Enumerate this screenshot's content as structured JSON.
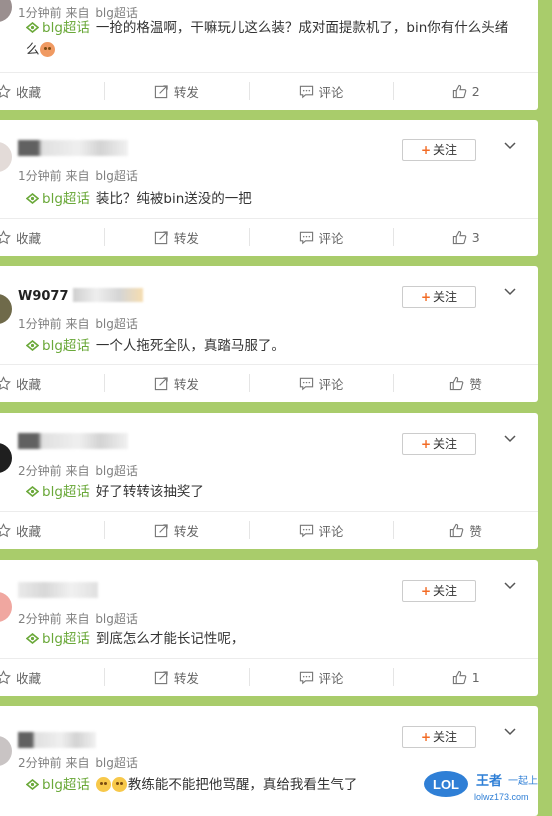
{
  "posts": [
    {
      "time": "1分钟前",
      "source_prefix": "来自",
      "source": "blg超话",
      "tag": "blg超话",
      "text": "一抢的格温啊，干嘛玩儿这么装？成对面提款机了，bin你有什么头绪么",
      "emoji": [
        "red"
      ],
      "likes": "2"
    },
    {
      "time": "1分钟前",
      "source_prefix": "来自",
      "source": "blg超话",
      "tag": "blg超话",
      "text": "装比？纯被bin送没的一把",
      "likes": "3"
    },
    {
      "username_fragment": "W9077",
      "time": "1分钟前",
      "source_prefix": "来自",
      "source": "blg超话",
      "tag": "blg超话",
      "text": "一个人拖死全队，真踏马服了。",
      "likes": "赞"
    },
    {
      "time": "2分钟前",
      "source_prefix": "来自",
      "source": "blg超话",
      "tag": "blg超话",
      "text": "好了转转该抽奖了",
      "likes": "赞"
    },
    {
      "time": "2分钟前",
      "source_prefix": "来自",
      "source": "blg超话",
      "tag": "blg超话",
      "text": "到底怎么才能长记性呢，",
      "likes": "1"
    },
    {
      "time": "2分钟前",
      "source_prefix": "来自",
      "source": "blg超话",
      "tag": "blg超话",
      "text": "教练能不能把他骂醒，真给我看生气了",
      "emoji": [
        "yellow",
        "yellow"
      ]
    }
  ],
  "labels": {
    "follow": "关注",
    "collect": "收藏",
    "repost": "转发",
    "comment": "评论"
  },
  "watermark": {
    "logo": "LOL",
    "title": "王者",
    "slogan": "一起上",
    "site": "lolwz173.com"
  },
  "colors": {
    "background": "#a9cc6b",
    "tag": "#6aa839",
    "follow_plus": "#f26b25"
  }
}
